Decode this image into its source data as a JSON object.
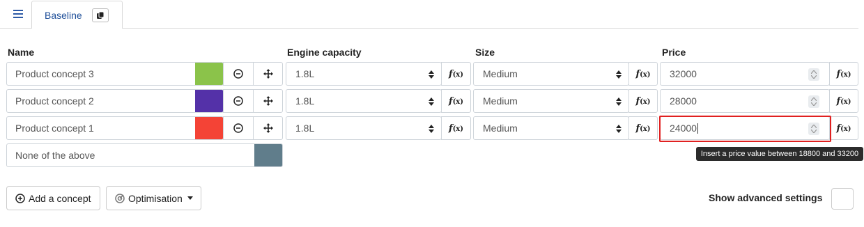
{
  "tabs": [
    {
      "label": "Baseline"
    }
  ],
  "columns": {
    "name": "Name",
    "engine": "Engine capacity",
    "size": "Size",
    "price": "Price"
  },
  "concepts": [
    {
      "name": "Product concept 3",
      "color": "#8bc34a",
      "engine": "1.8L",
      "size": "Medium",
      "price": "32000"
    },
    {
      "name": "Product concept 2",
      "color": "#5431a8",
      "engine": "1.8L",
      "size": "Medium",
      "price": "28000"
    },
    {
      "name": "Product concept 1",
      "color": "#f44336",
      "engine": "1.8L",
      "size": "Medium",
      "price": "24000"
    }
  ],
  "none_option": {
    "name": "None of the above",
    "color": "#607d8b"
  },
  "formula_label": {
    "f": "f",
    "x": "(x)"
  },
  "tooltip": "Insert a price value between 18800 and 33200",
  "buttons": {
    "add_concept": "Add a concept",
    "optimisation": "Optimisation"
  },
  "advanced": {
    "label": "Show advanced settings",
    "checked": false
  },
  "icons": {
    "menu": "hamburger-icon",
    "copy": "copy-icon",
    "remove": "minus-circle-icon",
    "move": "move-arrows-icon",
    "select": "updown-icon",
    "spinner": "spinner-icon",
    "add": "plus-circle-icon",
    "optimisation": "target-icon",
    "caret": "caret-down-icon"
  }
}
